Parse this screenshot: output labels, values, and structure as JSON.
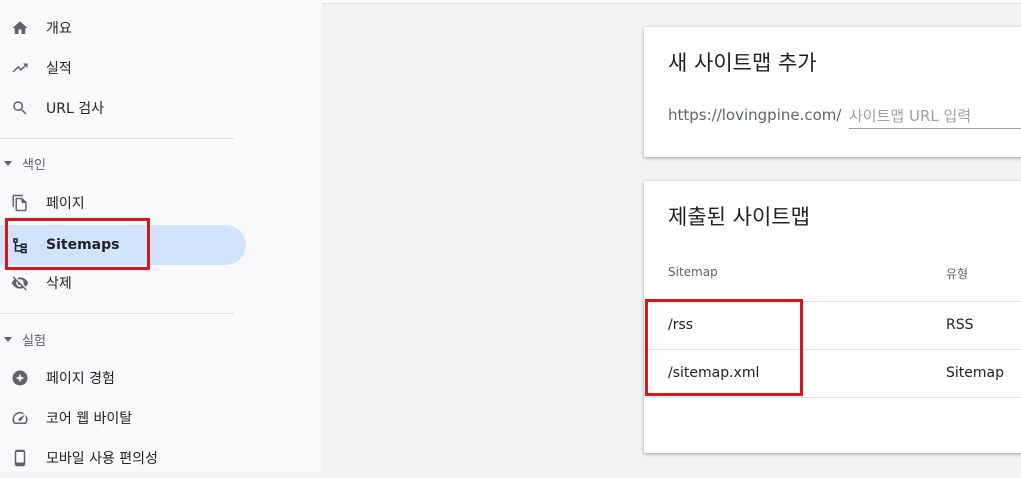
{
  "sidebar": {
    "items": [
      {
        "label": "개요",
        "icon": "home-icon"
      },
      {
        "label": "실적",
        "icon": "trending-up-icon"
      },
      {
        "label": "URL 검사",
        "icon": "search-icon"
      }
    ],
    "sections": [
      {
        "label": "색인",
        "items": [
          {
            "label": "페이지",
            "icon": "pages-icon"
          },
          {
            "label": "Sitemaps",
            "icon": "sitemap-icon",
            "active": true
          },
          {
            "label": "삭제",
            "icon": "visibility-off-icon"
          }
        ]
      },
      {
        "label": "실험",
        "items": [
          {
            "label": "페이지 경험",
            "icon": "page-experience-icon"
          },
          {
            "label": "코어 웹 바이탈",
            "icon": "speed-icon"
          },
          {
            "label": "모바일 사용 편의성",
            "icon": "smartphone-icon"
          }
        ]
      }
    ]
  },
  "add_sitemap": {
    "title": "새 사이트맵 추가",
    "url_prefix": "https://lovingpine.com/",
    "placeholder": "사이트맵 URL 입력"
  },
  "submitted": {
    "title": "제출된 사이트맵",
    "columns": [
      "Sitemap",
      "유형"
    ],
    "rows": [
      {
        "sitemap": "/rss",
        "type": "RSS"
      },
      {
        "sitemap": "/sitemap.xml",
        "type": "Sitemap"
      }
    ]
  },
  "colors": {
    "active_bg": "#d2e3fc",
    "highlight": "#d9161c",
    "icon": "#5f6368"
  }
}
